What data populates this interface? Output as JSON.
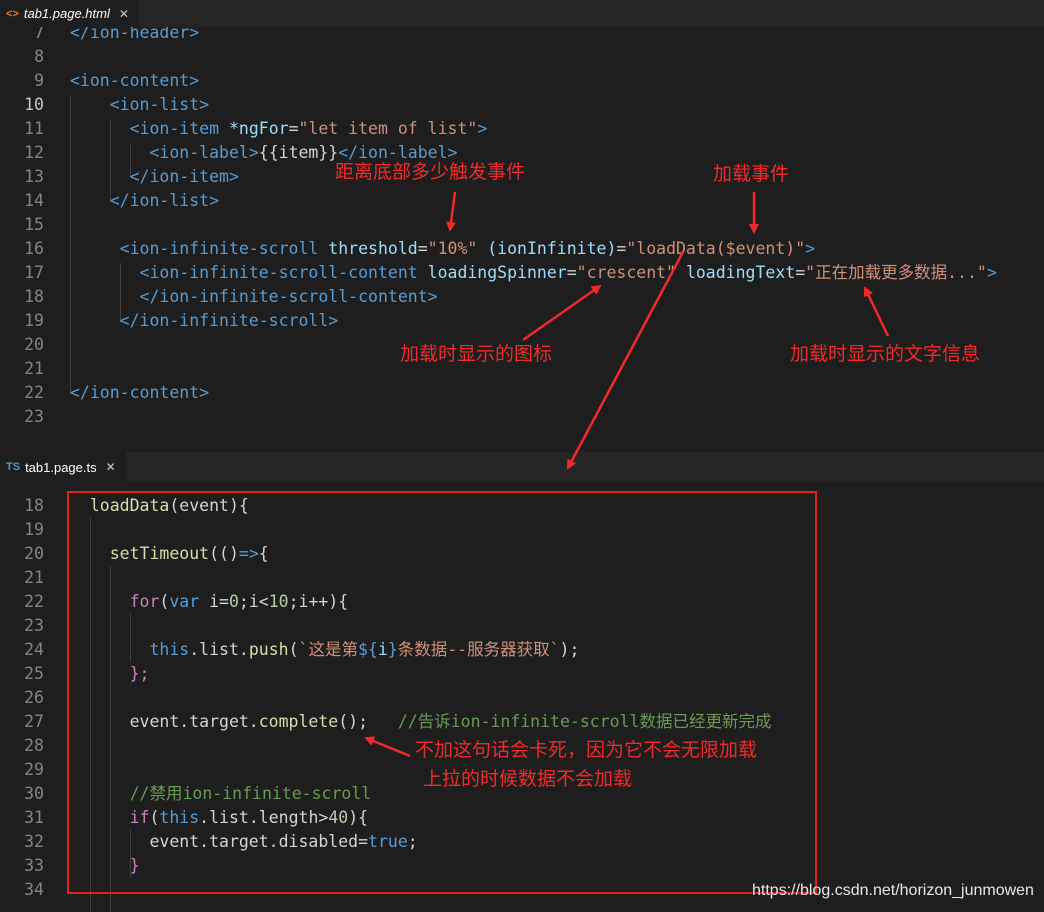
{
  "tabs": {
    "top": {
      "icon": "<>",
      "label": "tab1.page.html",
      "close": "✕"
    },
    "bottom": {
      "icon": "TS",
      "label": "tab1.page.ts",
      "close": "✕"
    }
  },
  "colors": {
    "tag": "#569cd6",
    "attr": "#9cdcfe",
    "string": "#ce9178",
    "comment": "#6a9955",
    "punct": "#808080",
    "func": "#dcdcaa",
    "keyword": "#c586c0",
    "number": "#b5cea8",
    "annotation": "#f02a2a"
  },
  "html_lines": [
    {
      "n": "7",
      "tokens": [
        [
          "tag",
          "</ion-header>"
        ]
      ]
    },
    {
      "n": "8",
      "tokens": []
    },
    {
      "n": "9",
      "tokens": [
        [
          "tag",
          "<ion-content>"
        ]
      ]
    },
    {
      "n": "10",
      "active": true,
      "tokens": [
        [
          "txt",
          "    "
        ],
        [
          "tag",
          "<ion-list>"
        ]
      ]
    },
    {
      "n": "11",
      "tokens": [
        [
          "txt",
          "      "
        ],
        [
          "tag",
          "<ion-item"
        ],
        [
          "txt",
          " "
        ],
        [
          "attr",
          "*ngFor"
        ],
        [
          "txt",
          "="
        ],
        [
          "str",
          "\"let item of list\""
        ],
        [
          "tag",
          ">"
        ]
      ]
    },
    {
      "n": "12",
      "tokens": [
        [
          "txt",
          "        "
        ],
        [
          "tag",
          "<ion-label>"
        ],
        [
          "txt",
          "{{item}}"
        ],
        [
          "tag",
          "</ion-label>"
        ]
      ]
    },
    {
      "n": "13",
      "tokens": [
        [
          "txt",
          "      "
        ],
        [
          "tag",
          "</ion-item>"
        ]
      ]
    },
    {
      "n": "14",
      "tokens": [
        [
          "txt",
          "    "
        ],
        [
          "tag",
          "</ion-list>"
        ]
      ]
    },
    {
      "n": "15",
      "tokens": []
    },
    {
      "n": "16",
      "tokens": [
        [
          "txt",
          "     "
        ],
        [
          "tag",
          "<ion-infinite-scroll"
        ],
        [
          "txt",
          " "
        ],
        [
          "attr",
          "threshold"
        ],
        [
          "txt",
          "="
        ],
        [
          "str",
          "\"10%\""
        ],
        [
          "txt",
          " "
        ],
        [
          "attr",
          "(ionInfinite)"
        ],
        [
          "txt",
          "="
        ],
        [
          "str",
          "\"loadData($event)\""
        ],
        [
          "tag",
          ">"
        ]
      ]
    },
    {
      "n": "17",
      "tokens": [
        [
          "txt",
          "       "
        ],
        [
          "tag",
          "<ion-infinite-scroll-content"
        ],
        [
          "txt",
          " "
        ],
        [
          "attr",
          "loadingSpinner"
        ],
        [
          "txt",
          "="
        ],
        [
          "str",
          "\"crescent\""
        ],
        [
          "txt",
          " "
        ],
        [
          "attr",
          "loadingText"
        ],
        [
          "txt",
          "="
        ],
        [
          "str",
          "\"正在加载更多数据...\""
        ],
        [
          "tag",
          ">"
        ]
      ]
    },
    {
      "n": "18",
      "tokens": [
        [
          "txt",
          "       "
        ],
        [
          "tag",
          "</ion-infinite-scroll-content>"
        ]
      ]
    },
    {
      "n": "19",
      "tokens": [
        [
          "txt",
          "     "
        ],
        [
          "tag",
          "</ion-infinite-scroll>"
        ]
      ]
    },
    {
      "n": "20",
      "tokens": []
    },
    {
      "n": "21",
      "tokens": []
    },
    {
      "n": "22",
      "tokens": [
        [
          "tag",
          "</ion-content>"
        ]
      ]
    },
    {
      "n": "23",
      "tokens": []
    }
  ],
  "ts_lines": [
    {
      "n": "18",
      "tokens": [
        [
          "txt",
          "  "
        ],
        [
          "fn",
          "loadData"
        ],
        [
          "txt",
          "(event){"
        ]
      ]
    },
    {
      "n": "19",
      "tokens": []
    },
    {
      "n": "20",
      "tokens": [
        [
          "txt",
          "    "
        ],
        [
          "fn",
          "setTimeout"
        ],
        [
          "txt",
          "(()"
        ],
        [
          "kw2",
          "=>"
        ],
        [
          "txt",
          "{"
        ]
      ]
    },
    {
      "n": "21",
      "tokens": []
    },
    {
      "n": "22",
      "tokens": [
        [
          "txt",
          "      "
        ],
        [
          "kw",
          "for"
        ],
        [
          "txt",
          "("
        ],
        [
          "kw2",
          "var"
        ],
        [
          "txt",
          " i="
        ],
        [
          "num",
          "0"
        ],
        [
          "txt",
          ";i<"
        ],
        [
          "num",
          "10"
        ],
        [
          "txt",
          ";i++){"
        ]
      ]
    },
    {
      "n": "23",
      "tokens": []
    },
    {
      "n": "24",
      "tokens": [
        [
          "txt",
          "        "
        ],
        [
          "kw2",
          "this"
        ],
        [
          "txt",
          ".list."
        ],
        [
          "fn",
          "push"
        ],
        [
          "txt",
          "("
        ],
        [
          "str",
          "`这是第"
        ],
        [
          "kw2",
          "${"
        ],
        [
          "attr",
          "i"
        ],
        [
          "kw2",
          "}"
        ],
        [
          "str",
          "条数据--服务器获取`"
        ],
        [
          "txt",
          ");"
        ]
      ]
    },
    {
      "n": "25",
      "tokens": [
        [
          "txt",
          "      "
        ],
        [
          "kw",
          "};"
        ]
      ]
    },
    {
      "n": "26",
      "tokens": []
    },
    {
      "n": "27",
      "tokens": [
        [
          "txt",
          "      event.target."
        ],
        [
          "fn",
          "complete"
        ],
        [
          "txt",
          "();   "
        ],
        [
          "cmt",
          "//告诉ion-infinite-scroll数据已经更新完成"
        ]
      ]
    },
    {
      "n": "28",
      "tokens": []
    },
    {
      "n": "29",
      "tokens": []
    },
    {
      "n": "30",
      "tokens": [
        [
          "txt",
          "      "
        ],
        [
          "cmt",
          "//禁用ion-infinite-scroll"
        ]
      ]
    },
    {
      "n": "31",
      "tokens": [
        [
          "txt",
          "      "
        ],
        [
          "kw",
          "if"
        ],
        [
          "txt",
          "("
        ],
        [
          "kw2",
          "this"
        ],
        [
          "txt",
          ".list.length>"
        ],
        [
          "num",
          "40"
        ],
        [
          "txt",
          "){"
        ]
      ]
    },
    {
      "n": "32",
      "tokens": [
        [
          "txt",
          "        event.target.disabled="
        ],
        [
          "kw2",
          "true"
        ],
        [
          "txt",
          ";"
        ]
      ]
    },
    {
      "n": "33",
      "tokens": [
        [
          "txt",
          "      "
        ],
        [
          "kw",
          "}"
        ]
      ]
    },
    {
      "n": "34",
      "tokens": []
    }
  ],
  "annotations": {
    "threshold": "距离底部多少触发事件",
    "event": "加载事件",
    "spinner": "加载时显示的图标",
    "text": "加载时显示的文字信息",
    "complete_line1": "不加这句话会卡死，因为它不会无限加载",
    "complete_line2": "上拉的时候数据不会加载"
  },
  "watermark": "https://blog.csdn.net/horizon_junmowen"
}
